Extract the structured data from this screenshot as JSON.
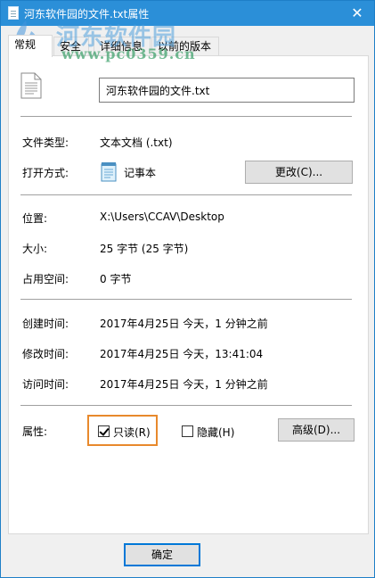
{
  "window": {
    "title": "河东软件园的文件.txt属性",
    "close_glyph": "✕"
  },
  "watermark": {
    "title": "河东软件园",
    "url": "www.pc0359.cn"
  },
  "tabs": [
    {
      "label": "常规",
      "active": true
    },
    {
      "label": "安全",
      "active": false
    },
    {
      "label": "详细信息",
      "active": false
    },
    {
      "label": "以前的版本",
      "active": false
    }
  ],
  "file": {
    "name": "河东软件园的文件.txt",
    "icon": "text-file-icon"
  },
  "fields": {
    "type_label": "文件类型:",
    "type_value": "文本文档 (.txt)",
    "opener_label": "打开方式:",
    "opener_value": "记事本",
    "opener_icon": "notepad-icon",
    "change_button": "更改(C)...",
    "location_label": "位置:",
    "location_value": "X:\\Users\\CCAV\\Desktop",
    "size_label": "大小:",
    "size_value": "25 字节 (25 字节)",
    "disk_label": "占用空间:",
    "disk_value": "0 字节",
    "created_label": "创建时间:",
    "created_value": "2017年4月25日 今天，1 分钟之前",
    "modified_label": "修改时间:",
    "modified_value": "2017年4月25日 今天，13:41:04",
    "accessed_label": "访问时间:",
    "accessed_value": "2017年4月25日 今天，1 分钟之前"
  },
  "attributes": {
    "label": "属性:",
    "readonly_label": "只读(R)",
    "readonly_checked": true,
    "hidden_label": "隐藏(H)",
    "hidden_checked": false,
    "advanced_button": "高级(D)..."
  },
  "footer": {
    "ok_button": "确定"
  },
  "colors": {
    "titlebar": "#2b8fd8",
    "highlight": "#e8892c"
  }
}
